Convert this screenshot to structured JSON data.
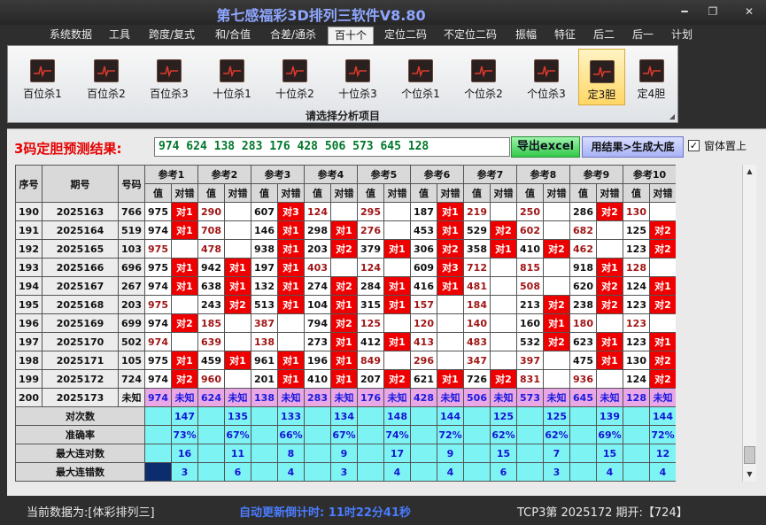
{
  "app": {
    "title": "第七感福彩3D排列三软件V8.80",
    "min_btn": "━",
    "max_btn": "❐",
    "close_btn": "✕"
  },
  "menu": [
    {
      "label": "系统数据"
    },
    {
      "label": "工具"
    },
    {
      "label": "跨度/复式"
    },
    {
      "label": "和/合值"
    },
    {
      "label": "合差/通杀"
    },
    {
      "label": "百十个",
      "active": true
    },
    {
      "label": "定位二码"
    },
    {
      "label": "不定位二码"
    },
    {
      "label": "振幅"
    },
    {
      "label": "特征"
    },
    {
      "label": "后二"
    },
    {
      "label": "后一"
    },
    {
      "label": "计划"
    }
  ],
  "ribbon": {
    "caption": "请选择分析项目",
    "buttons": [
      {
        "label": "百位杀1"
      },
      {
        "label": "百位杀2"
      },
      {
        "label": "百位杀3"
      },
      {
        "label": "十位杀1"
      },
      {
        "label": "十位杀2"
      },
      {
        "label": "十位杀3"
      },
      {
        "label": "个位杀1"
      },
      {
        "label": "个位杀2"
      },
      {
        "label": "个位杀3"
      },
      {
        "label": "定3胆",
        "active": true
      },
      {
        "label": "定4胆"
      }
    ]
  },
  "prediction": {
    "label": "3码定胆预测结果:",
    "value": "974 624 138 283 176 428 506 573 645 128",
    "export_button": "导出excel",
    "generate_button": "用结果>生成大底",
    "checkbox_checked": "✓",
    "checkbox_label": "窗体置上"
  },
  "table": {
    "headers": {
      "seq": "序号",
      "issue": "期号",
      "number": "号码",
      "refs": [
        "参考1",
        "参考2",
        "参考3",
        "参考4",
        "参考5",
        "参考6",
        "参考7",
        "参考8",
        "参考9",
        "参考10"
      ],
      "value": "值",
      "judge": "对错"
    },
    "rows": [
      {
        "seq": "190",
        "issue": "2025163",
        "number": "766",
        "refs": [
          [
            "975",
            "对1"
          ],
          [
            "290",
            ""
          ],
          [
            "607",
            "对3"
          ],
          [
            "124",
            ""
          ],
          [
            "295",
            ""
          ],
          [
            "187",
            "对1"
          ],
          [
            "219",
            ""
          ],
          [
            "250",
            ""
          ],
          [
            "286",
            "对2"
          ],
          [
            "130",
            ""
          ]
        ]
      },
      {
        "seq": "191",
        "issue": "2025164",
        "number": "519",
        "refs": [
          [
            "974",
            "对1"
          ],
          [
            "708",
            ""
          ],
          [
            "146",
            "对1"
          ],
          [
            "298",
            "对1"
          ],
          [
            "276",
            ""
          ],
          [
            "453",
            "对1"
          ],
          [
            "529",
            "对2"
          ],
          [
            "602",
            ""
          ],
          [
            "682",
            ""
          ],
          [
            "125",
            "对2"
          ]
        ]
      },
      {
        "seq": "192",
        "issue": "2025165",
        "number": "103",
        "refs": [
          [
            "975",
            ""
          ],
          [
            "478",
            ""
          ],
          [
            "938",
            "对1"
          ],
          [
            "203",
            "对2"
          ],
          [
            "379",
            "对1"
          ],
          [
            "306",
            "对2"
          ],
          [
            "358",
            "对1"
          ],
          [
            "410",
            "对2"
          ],
          [
            "462",
            ""
          ],
          [
            "123",
            "对2"
          ]
        ]
      },
      {
        "seq": "193",
        "issue": "2025166",
        "number": "696",
        "refs": [
          [
            "975",
            "对1"
          ],
          [
            "942",
            "对1"
          ],
          [
            "197",
            "对1"
          ],
          [
            "403",
            ""
          ],
          [
            "124",
            ""
          ],
          [
            "609",
            "对3"
          ],
          [
            "712",
            ""
          ],
          [
            "815",
            ""
          ],
          [
            "918",
            "对1"
          ],
          [
            "128",
            ""
          ]
        ]
      },
      {
        "seq": "194",
        "issue": "2025167",
        "number": "267",
        "refs": [
          [
            "974",
            "对1"
          ],
          [
            "638",
            "对1"
          ],
          [
            "132",
            "对1"
          ],
          [
            "274",
            "对2"
          ],
          [
            "284",
            "对1"
          ],
          [
            "416",
            "对1"
          ],
          [
            "481",
            ""
          ],
          [
            "508",
            ""
          ],
          [
            "620",
            "对2"
          ],
          [
            "124",
            "对1"
          ]
        ]
      },
      {
        "seq": "195",
        "issue": "2025168",
        "number": "203",
        "refs": [
          [
            "975",
            ""
          ],
          [
            "243",
            "对2"
          ],
          [
            "513",
            "对1"
          ],
          [
            "104",
            "对1"
          ],
          [
            "315",
            "对1"
          ],
          [
            "157",
            ""
          ],
          [
            "184",
            ""
          ],
          [
            "213",
            "对2"
          ],
          [
            "238",
            "对2"
          ],
          [
            "123",
            "对2"
          ]
        ]
      },
      {
        "seq": "196",
        "issue": "2025169",
        "number": "699",
        "refs": [
          [
            "974",
            "对2"
          ],
          [
            "185",
            ""
          ],
          [
            "387",
            ""
          ],
          [
            "794",
            "对2"
          ],
          [
            "125",
            ""
          ],
          [
            "120",
            ""
          ],
          [
            "140",
            ""
          ],
          [
            "160",
            "对1"
          ],
          [
            "180",
            ""
          ],
          [
            "123",
            ""
          ]
        ]
      },
      {
        "seq": "197",
        "issue": "2025170",
        "number": "502",
        "refs": [
          [
            "974",
            ""
          ],
          [
            "639",
            ""
          ],
          [
            "138",
            ""
          ],
          [
            "273",
            "对1"
          ],
          [
            "412",
            "对1"
          ],
          [
            "413",
            ""
          ],
          [
            "483",
            ""
          ],
          [
            "532",
            "对2"
          ],
          [
            "623",
            "对1"
          ],
          [
            "123",
            "对1"
          ]
        ]
      },
      {
        "seq": "198",
        "issue": "2025171",
        "number": "105",
        "refs": [
          [
            "975",
            "对1"
          ],
          [
            "459",
            "对1"
          ],
          [
            "961",
            "对1"
          ],
          [
            "196",
            "对1"
          ],
          [
            "849",
            ""
          ],
          [
            "296",
            ""
          ],
          [
            "347",
            ""
          ],
          [
            "397",
            ""
          ],
          [
            "475",
            "对1"
          ],
          [
            "130",
            "对2"
          ]
        ]
      },
      {
        "seq": "199",
        "issue": "2025172",
        "number": "724",
        "refs": [
          [
            "974",
            "对2"
          ],
          [
            "960",
            ""
          ],
          [
            "201",
            "对1"
          ],
          [
            "410",
            "对1"
          ],
          [
            "207",
            "对2"
          ],
          [
            "621",
            "对1"
          ],
          [
            "726",
            "对2"
          ],
          [
            "831",
            ""
          ],
          [
            "936",
            ""
          ],
          [
            "124",
            "对2"
          ]
        ]
      },
      {
        "seq": "200",
        "issue": "2025173",
        "number": "未知",
        "refs": [
          [
            "974",
            "未知"
          ],
          [
            "624",
            "未知"
          ],
          [
            "138",
            "未知"
          ],
          [
            "283",
            "未知"
          ],
          [
            "176",
            "未知"
          ],
          [
            "428",
            "未知"
          ],
          [
            "506",
            "未知"
          ],
          [
            "573",
            "未知"
          ],
          [
            "645",
            "未知"
          ],
          [
            "128",
            "未知"
          ]
        ]
      }
    ],
    "stats": [
      {
        "label": "对次数",
        "values": [
          "147",
          "135",
          "133",
          "134",
          "148",
          "144",
          "125",
          "125",
          "139",
          "144"
        ]
      },
      {
        "label": "准确率",
        "values": [
          "73%",
          "67%",
          "66%",
          "67%",
          "74%",
          "72%",
          "62%",
          "62%",
          "69%",
          "72%"
        ]
      },
      {
        "label": "最大连对数",
        "values": [
          "16",
          "11",
          "8",
          "9",
          "17",
          "9",
          "15",
          "7",
          "15",
          "12"
        ]
      },
      {
        "label": "最大连错数",
        "values": [
          "3",
          "6",
          "4",
          "3",
          "4",
          "4",
          "6",
          "3",
          "4",
          "4"
        ]
      }
    ]
  },
  "status": {
    "data_source": "当前数据为:[体彩排列三]",
    "countdown": "自动更新倒计时: 11时22分41秒",
    "last_draw": "TCP3第 2025172 期开:【724】"
  },
  "colors": {
    "hit": "#ee0000",
    "stats_bg": "#7ef3f3",
    "unknown_row": "#e9a7e5",
    "prediction_text": "#00772a",
    "title_text": "#8ea6ff"
  }
}
